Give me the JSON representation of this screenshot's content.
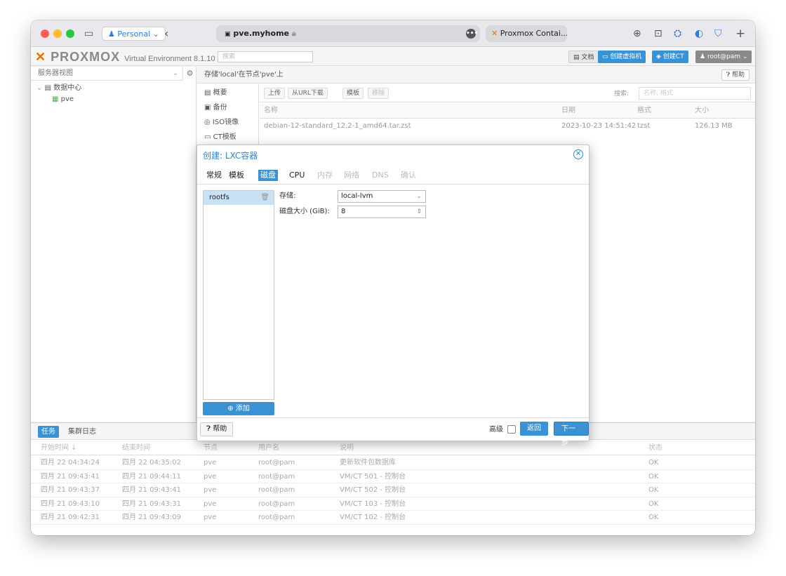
{
  "browser": {
    "profile": "Personal",
    "url": "pve.myhome",
    "tab2_title": "Proxmox Contai..."
  },
  "header": {
    "logo_proxmox": "PROXMOX",
    "logo_ve": "Virtual Environment 8.1.10",
    "search_placeholder": "搜索",
    "docs": "文档",
    "create_vm": "创建虚拟机",
    "create_ct": "创建CT",
    "user": "root@pam"
  },
  "sidebar": {
    "view": "服务器视图",
    "datacenter": "数据中心",
    "node": "pve"
  },
  "main": {
    "title": "存储'local'在节点'pve'上",
    "help": "帮助",
    "nav": [
      "概要",
      "备份",
      "ISO镜像",
      "CT模板"
    ],
    "toolbar": {
      "upload": "上传",
      "download_url": "从URL下载",
      "templates": "模板",
      "remove": "移除",
      "search_label": "搜索:",
      "search_placeholder": "名称, 格式"
    },
    "columns": {
      "name": "名称",
      "date": "日期",
      "format": "格式",
      "size": "大小"
    },
    "rows": [
      {
        "name": "debian-12-standard_12.2-1_amd64.tar.zst",
        "date": "2023-10-23 14:51:42",
        "format": "tzst",
        "size": "126.13 MB"
      }
    ]
  },
  "dialog": {
    "title": "创建: LXC容器",
    "tabs": [
      "常规",
      "模板",
      "磁盘",
      "CPU",
      "内存",
      "网络",
      "DNS",
      "确认"
    ],
    "active_tab": "磁盘",
    "disk_item": "rootfs",
    "add": "添加",
    "storage_label": "存储:",
    "storage_value": "local-lvm",
    "size_label": "磁盘大小 (GiB):",
    "size_value": "8",
    "help": "帮助",
    "advanced": "高级",
    "back": "返回",
    "next": "下一步"
  },
  "bottom": {
    "tabs": [
      "任务",
      "集群日志"
    ],
    "columns": {
      "start": "开始时间 ↓",
      "end": "结束时间",
      "node": "节点",
      "user": "用户名",
      "desc": "说明",
      "status": "状态"
    },
    "rows": [
      {
        "start": "四月 22 04:34:24",
        "end": "四月 22 04:35:02",
        "node": "pve",
        "user": "root@pam",
        "desc": "更新软件包数据库",
        "status": "OK"
      },
      {
        "start": "四月 21 09:43:41",
        "end": "四月 21 09:44:11",
        "node": "pve",
        "user": "root@pam",
        "desc": "VM/CT 501 - 控制台",
        "status": "OK"
      },
      {
        "start": "四月 21 09:43:37",
        "end": "四月 21 09:43:41",
        "node": "pve",
        "user": "root@pam",
        "desc": "VM/CT 502 - 控制台",
        "status": "OK"
      },
      {
        "start": "四月 21 09:43:10",
        "end": "四月 21 09:43:31",
        "node": "pve",
        "user": "root@pam",
        "desc": "VM/CT 103 - 控制台",
        "status": "OK"
      },
      {
        "start": "四月 21 09:42:31",
        "end": "四月 21 09:43:09",
        "node": "pve",
        "user": "root@pam",
        "desc": "VM/CT 102 - 控制台",
        "status": "OK"
      }
    ]
  },
  "colors": {
    "accent": "#3892d4",
    "logo_orange": "#e57000"
  }
}
